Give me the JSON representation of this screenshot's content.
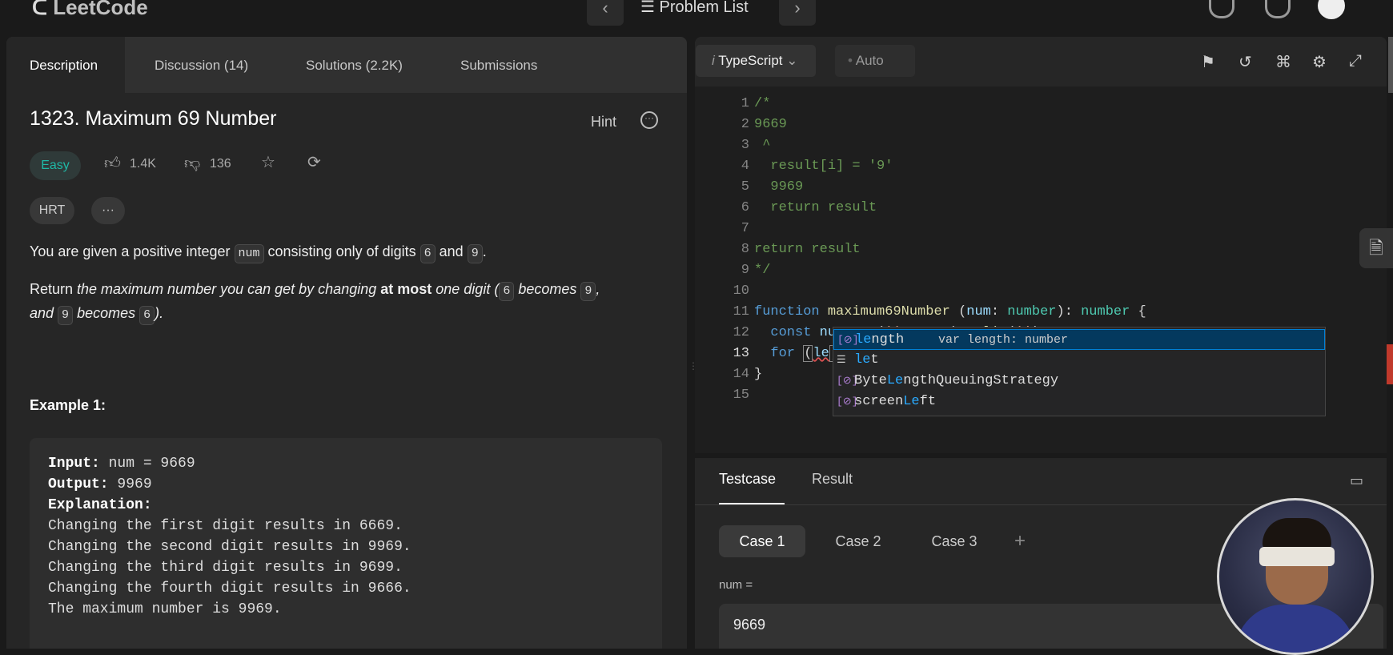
{
  "topbar": {
    "logo": "LeetCode",
    "problem_list": "Problem List",
    "prev": "‹",
    "next": "›"
  },
  "left_tabs": [
    {
      "label": "Description"
    },
    {
      "label": "Discussion (14)"
    },
    {
      "label": "Solutions (2.2K)"
    },
    {
      "label": "Submissions"
    }
  ],
  "problem": {
    "title": "1323. Maximum 69 Number",
    "hint": "Hint",
    "difficulty": "Easy",
    "likes": "1.4K",
    "dislikes": "136",
    "tag": "HRT",
    "more": "···",
    "p1_a": "You are given a positive integer ",
    "p1_code": "num",
    "p1_b": " consisting only of digits ",
    "p1_d1": "6",
    "p1_c": " and ",
    "p1_d2": "9",
    "p1_end": ".",
    "p2_a": "Return ",
    "p2_i1": "the maximum number you can get by changing ",
    "p2_bold": "at most",
    "p2_i2": " one digit (",
    "p2_c1": "6",
    "p2_i3": " becomes ",
    "p2_c2": "9",
    "p2_i4": ",",
    "p2_i5": "and ",
    "p2_c3": "9",
    "p2_i6": " becomes ",
    "p2_c4": "6",
    "p2_i7": ").",
    "example_title": "Example 1:",
    "example": {
      "input_label": "Input:",
      "input_val": " num = 9669",
      "output_label": "Output:",
      "output_val": " 9969",
      "expl_label": "Explanation:",
      "lines": [
        "Changing the first digit results in 6669.",
        "Changing the second digit results in 9969.",
        "Changing the third digit results in 9699.",
        "Changing the fourth digit results in 9666.",
        "The maximum number is 9969."
      ]
    }
  },
  "editor": {
    "language": "TypeScript",
    "auto": "Auto",
    "line_numbers": [
      "1",
      "2",
      "3",
      "4",
      "5",
      "6",
      "7",
      "8",
      "9",
      "10",
      "11",
      "12",
      "13",
      "14",
      "15"
    ],
    "suggestions": [
      {
        "hl": "le",
        "rest": "ngth",
        "detail": "var length: number",
        "selected": true
      },
      {
        "hl": "le",
        "rest": "t",
        "detail": "",
        "selected": false
      },
      {
        "pre": "Byte",
        "hl": "Le",
        "rest": "ngthQueuingStrategy",
        "detail": "",
        "selected": false
      },
      {
        "pre": "screen",
        "hl": "Le",
        "rest": "ft",
        "detail": "",
        "selected": false
      }
    ]
  },
  "bottom": {
    "tab_testcase": "Testcase",
    "tab_result": "Result",
    "cases": [
      "Case 1",
      "Case 2",
      "Case 3"
    ],
    "add": "+",
    "num_label": "num =",
    "num_value": "9669"
  }
}
